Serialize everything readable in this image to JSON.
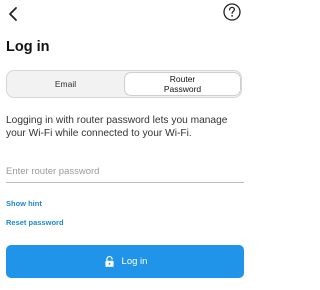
{
  "header": {
    "back_icon": "chevron-left-icon",
    "help_icon": "question-circle-icon",
    "title": "Log in"
  },
  "tabs": {
    "email_label": "Email",
    "router_label": "Router\nPassword",
    "selected": "router"
  },
  "description": "Logging in with router password lets you manage your Wi-Fi while connected to your Wi-Fi.",
  "password_field": {
    "value": "",
    "placeholder": "Enter router password"
  },
  "links": {
    "show_hint": "Show hint",
    "reset_password": "Reset password"
  },
  "login_button": {
    "label": "Log in",
    "icon": "lock-icon"
  },
  "colors": {
    "accent": "#1f94e8",
    "link": "#1f86d6"
  }
}
